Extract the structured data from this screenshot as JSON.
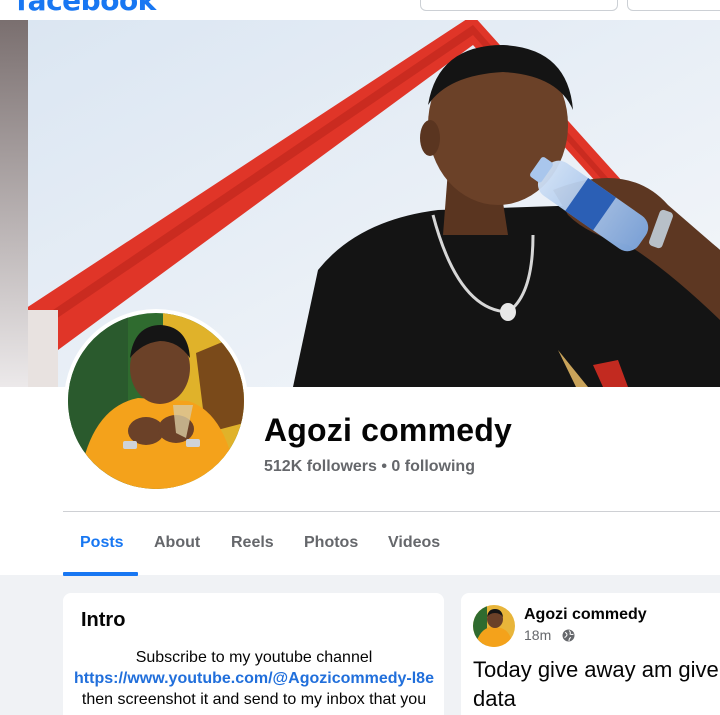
{
  "header": {
    "logo": "facebook"
  },
  "profile": {
    "name": "Agozi commedy",
    "stats": "512K followers • 0 following"
  },
  "tabs": [
    {
      "label": "Posts",
      "active": true
    },
    {
      "label": "About"
    },
    {
      "label": "Reels"
    },
    {
      "label": "Photos"
    },
    {
      "label": "Videos"
    }
  ],
  "intro": {
    "title": "Intro",
    "line1": "Subscribe to my youtube channel",
    "link": "https://www.youtube.com/@Agozicommedy-l8e",
    "line3": "then screenshot it and send to my inbox that you"
  },
  "post": {
    "author": "Agozi commedy",
    "time": "18m",
    "privacy_icon": "globe-icon",
    "text": "Today give away am give data"
  },
  "colors": {
    "accent": "#1877f2",
    "link": "#216fdb",
    "secondary_text": "#65676b",
    "background": "#f0f2f5"
  }
}
